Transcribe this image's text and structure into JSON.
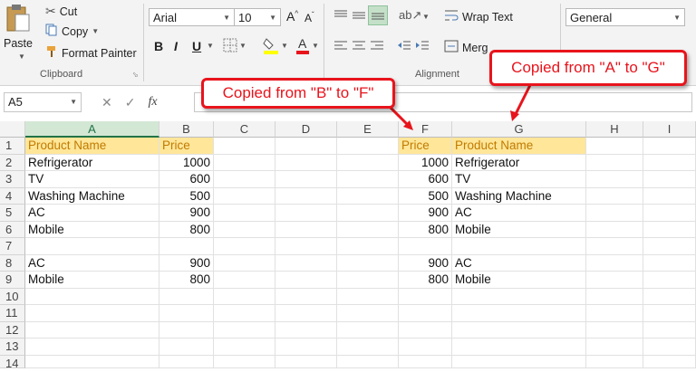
{
  "clipboard": {
    "paste": "Paste",
    "cut": "Cut",
    "copy": "Copy",
    "format_painter": "Format Painter",
    "group_label": "Clipboard"
  },
  "font": {
    "name": "Arial",
    "size": "10",
    "bold": "B",
    "italic": "I",
    "underline": "U"
  },
  "alignment": {
    "wrap_text": "Wrap Text",
    "merge": "Merg",
    "group_label": "Alignment"
  },
  "number": {
    "format": "General"
  },
  "formula_bar": {
    "name_box": "A5",
    "fx": "fx"
  },
  "columns": [
    "A",
    "B",
    "C",
    "D",
    "E",
    "F",
    "G",
    "H",
    "I"
  ],
  "rows": [
    "1",
    "2",
    "3",
    "4",
    "5",
    "6",
    "7",
    "8",
    "9",
    "10",
    "11",
    "12",
    "13",
    "14"
  ],
  "cells": {
    "A1": "Product Name",
    "B1": "Price",
    "F1": "Price",
    "G1": "Product Name",
    "A2": "Refrigerator",
    "B2": "1000",
    "F2": "1000",
    "G2": "Refrigerator",
    "A3": "TV",
    "B3": "600",
    "F3": "600",
    "G3": "TV",
    "A4": "Washing Machine",
    "B4": "500",
    "F4": "500",
    "G4": "Washing Machine",
    "A5": "AC",
    "B5": "900",
    "F5": "900",
    "G5": "AC",
    "A6": "Mobile",
    "B6": "800",
    "F6": "800",
    "G6": "Mobile",
    "A8": "AC",
    "B8": "900",
    "F8": "900",
    "G8": "AC",
    "A9": "Mobile",
    "B9": "800",
    "F9": "800",
    "G9": "Mobile"
  },
  "annotations": {
    "callout_b_to_f": "Copied from \"B\" to \"F\"",
    "callout_a_to_g": "Copied from \"A\" to \"G\""
  },
  "colors": {
    "header_fill": "#ffe699",
    "header_text": "#c07b00",
    "callout_red": "#e8141c",
    "selected_header": "#217346"
  }
}
